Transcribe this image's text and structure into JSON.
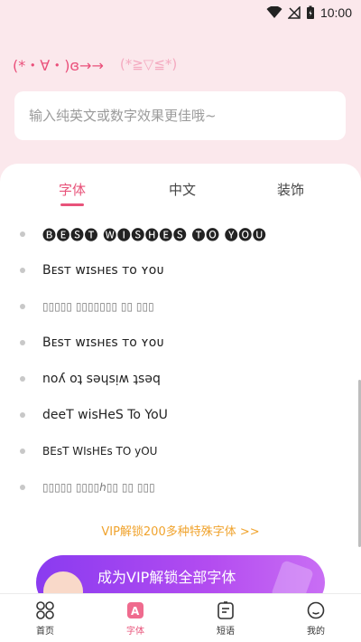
{
  "status_bar": {
    "time": "10:00"
  },
  "header": {
    "kaomoji_primary": "(*・∀・)ɞ→→",
    "kaomoji_secondary": "(*≧▽≦*)"
  },
  "input": {
    "placeholder": "输入纯英文或数字效果更佳哦~",
    "value": ""
  },
  "tabs": [
    {
      "label": "字体",
      "active": true
    },
    {
      "label": "中文",
      "active": false
    },
    {
      "label": "装饰",
      "active": false
    }
  ],
  "fonts": [
    {
      "sample": "🅑🅔🅢🅣 🅦🅘🅢🅗🅔🅢 🅣🅞 🅨🅞🅤"
    },
    {
      "sample": "Bᴇѕᴛ ᴡɪѕʜᴇѕ ᴛᴏ ʏᴏᴜ"
    },
    {
      "sample": "▯▯▯▯▯ ▯▯▯▯▯▯▯ ▯▯ ▯▯▯"
    },
    {
      "sample": "Bᴇsᴛ ᴡɪsʜᴇs ᴛᴏ ʏᴏᴜ"
    },
    {
      "sample": "noʎ oʇ sǝɥsᴉʍ ʇsǝq"
    },
    {
      "sample": "deeT wisHeS To YoU"
    },
    {
      "sample": "BEsT WIsHEs TO yOU"
    },
    {
      "sample": "▯▯▯▯▯ ▯▯▯▯ℎ▯▯ ▯▯ ▯▯▯"
    }
  ],
  "vip": {
    "link_text": "VIP解锁200多种特殊字体 >>",
    "banner_text": "成为VIP解锁全部字体"
  },
  "bottom_nav": [
    {
      "label": "首页",
      "icon": "home-grid-icon",
      "active": false
    },
    {
      "label": "字体",
      "icon": "font-icon",
      "active": true
    },
    {
      "label": "短语",
      "icon": "phrase-icon",
      "active": false
    },
    {
      "label": "我的",
      "icon": "profile-icon",
      "active": false
    }
  ],
  "colors": {
    "accent": "#e8537a",
    "vip_orange": "#f0a32d",
    "vip_purple": "#8a3bf0",
    "header_bg": "#fbe8ec"
  }
}
